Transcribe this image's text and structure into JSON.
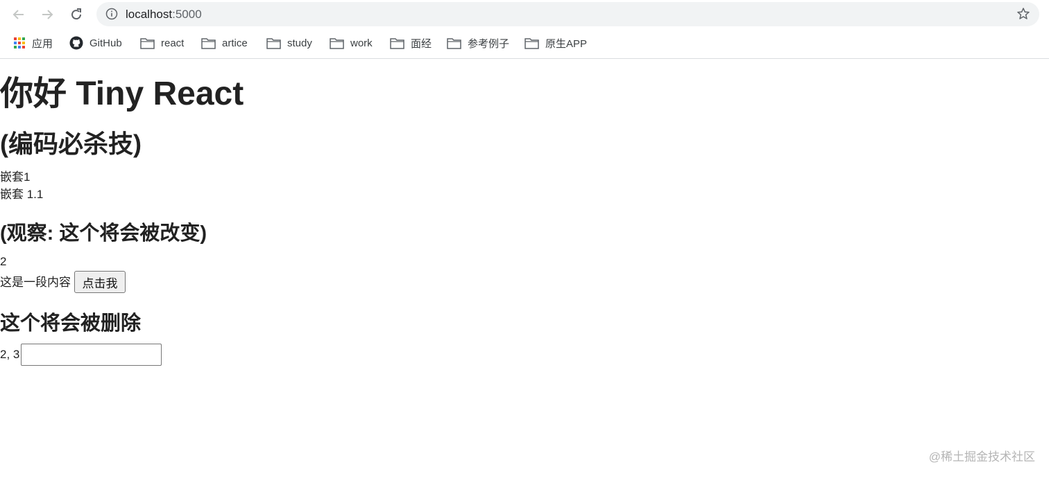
{
  "browser": {
    "url_host": "localhost",
    "url_port": ":5000",
    "bookmarks": [
      "应用",
      "GitHub",
      "react",
      "artice",
      "study",
      "work",
      "面经",
      "参考例子",
      "原生APP"
    ]
  },
  "page": {
    "title": "你好 Tiny React",
    "subtitle": "(编码必杀技)",
    "nested_1": "嵌套1",
    "nested_1_1": "嵌套 1.1",
    "observe_heading": "(观察: 这个将会被改变)",
    "number_line": "2",
    "paragraph": "这是一段内容",
    "button_label": "点击我",
    "delete_heading": "这个将会被删除",
    "list_text": "2, 3",
    "input_value": ""
  },
  "watermark": "@稀土掘金技术社区"
}
